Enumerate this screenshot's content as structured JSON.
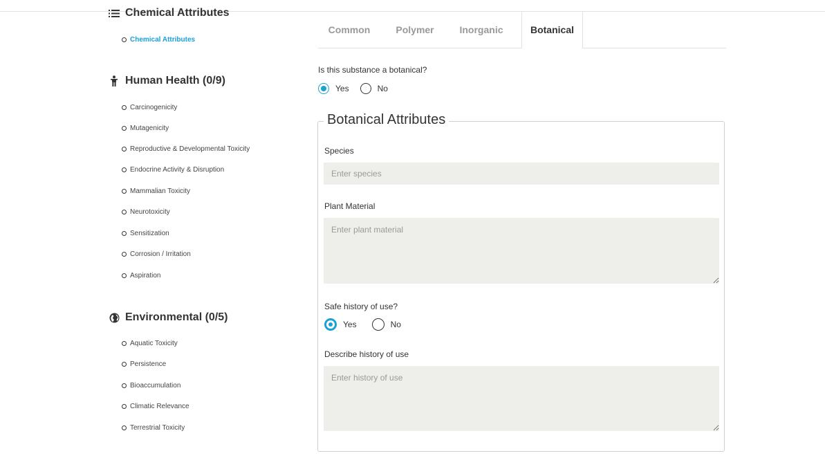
{
  "sidebar": {
    "chemical": {
      "header": "Chemical Attributes",
      "icon": "list-icon",
      "items": [
        "Chemical Attributes"
      ]
    },
    "human_health": {
      "header": "Human Health (0/9)",
      "icon": "person-icon",
      "items": [
        "Carcinogenicity",
        "Mutagenicity",
        "Reproductive & Developmental Toxicity",
        "Endocrine Activity & Disruption",
        "Mammalian Toxicity",
        "Neurotoxicity",
        "Sensitization",
        "Corrosion / Irritation",
        "Aspiration"
      ]
    },
    "environmental": {
      "header": "Environmental (0/5)",
      "icon": "globe-icon",
      "items": [
        "Aquatic Toxicity",
        "Persistence",
        "Bioaccumulation",
        "Climatic Relevance",
        "Terrestrial Toxicity"
      ]
    }
  },
  "tabs": [
    "Common",
    "Polymer",
    "Inorganic",
    "Botanical"
  ],
  "active_tab": "Botanical",
  "botanical_question": {
    "label": "Is this substance a botanical?",
    "yes": "Yes",
    "no": "No",
    "selected": "Yes"
  },
  "botanical_attributes": {
    "legend": "Botanical Attributes",
    "species": {
      "label": "Species",
      "placeholder": "Enter species",
      "value": ""
    },
    "plant_material": {
      "label": "Plant Material",
      "placeholder": "Enter plant material",
      "value": ""
    },
    "safe_history": {
      "label": "Safe history of use?",
      "yes": "Yes",
      "no": "No",
      "selected": "Yes"
    },
    "history": {
      "label": "Describe history of use",
      "placeholder": "Enter history of use",
      "value": ""
    }
  },
  "colors": {
    "accent": "#1ba0d7",
    "input_bg": "#eeefea"
  }
}
